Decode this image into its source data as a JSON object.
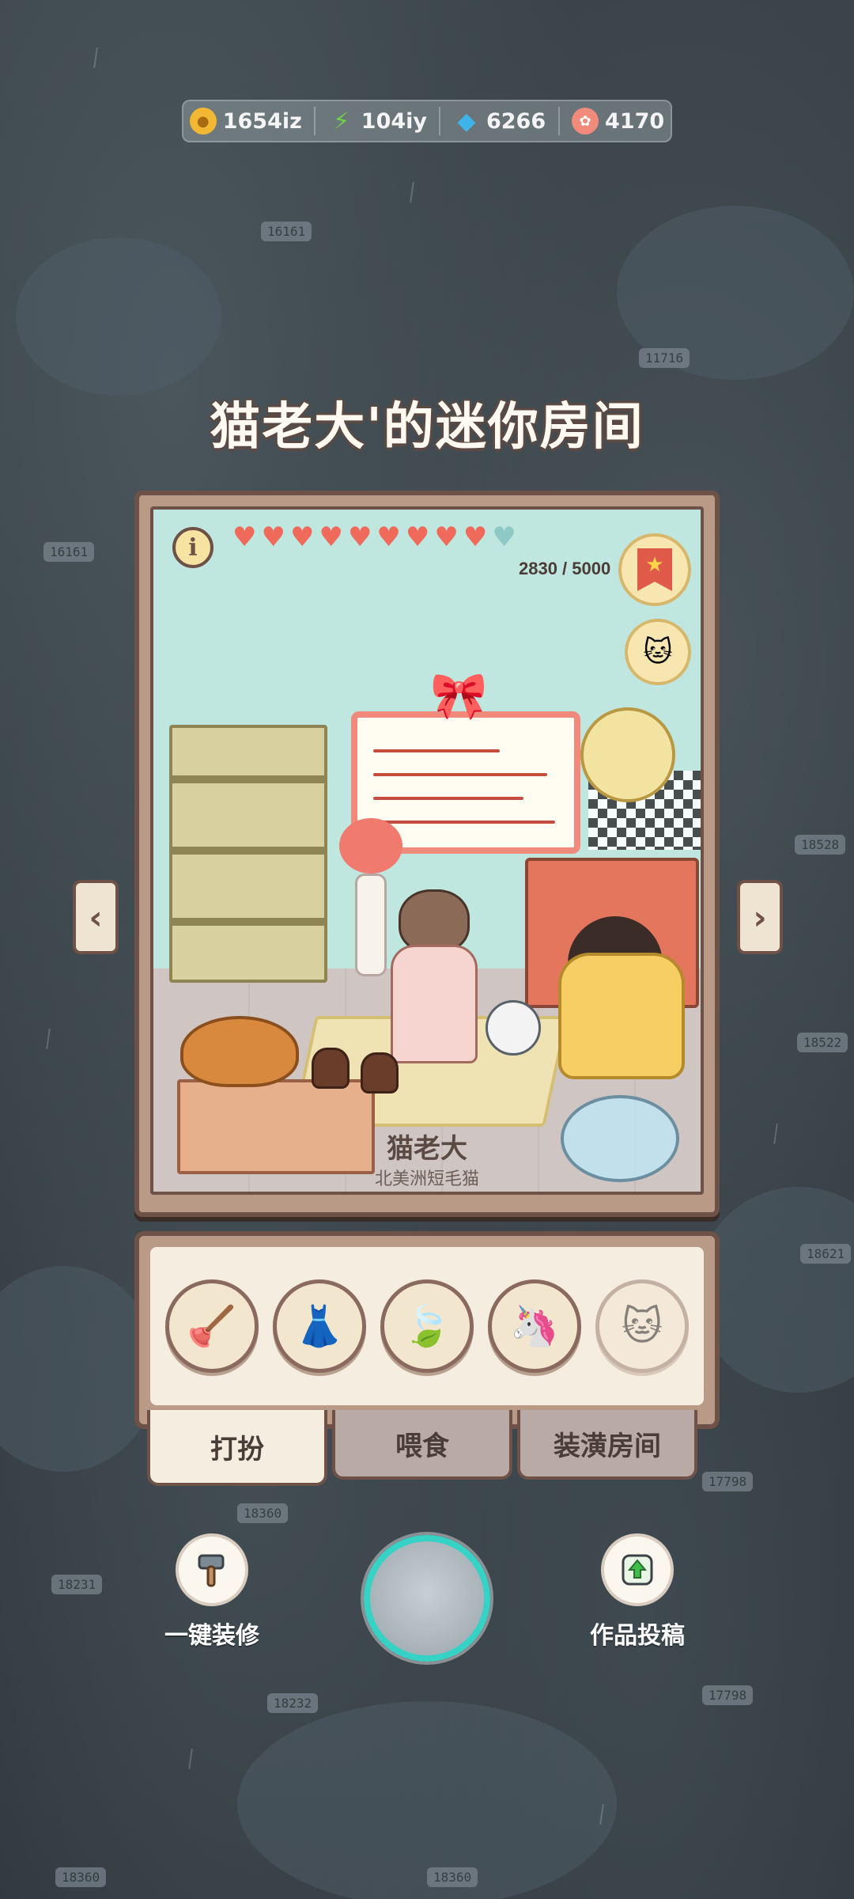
{
  "currencies": [
    {
      "name": "coin",
      "icon": "coin-icon",
      "value": "1654iz",
      "color": "#f2b733"
    },
    {
      "name": "energy",
      "icon": "lightning-icon",
      "value": "104iy",
      "color": "#6fd04a"
    },
    {
      "name": "gem",
      "icon": "gem-icon",
      "value": "6266",
      "color": "#3fb4e8"
    },
    {
      "name": "shell",
      "icon": "shell-icon",
      "value": "4170",
      "color": "#f08a7a"
    }
  ],
  "room": {
    "title": "猫老大'的迷你房间",
    "hearts_filled": 9,
    "hearts_total": 10,
    "progress_text": "2830 / 5000",
    "progress_fraction": 0.566,
    "cat_name": "猫老大",
    "cat_breed": "北美洲短毛猫"
  },
  "items": [
    {
      "icon": "plunger-icon",
      "glyph": "🪠"
    },
    {
      "icon": "dress-icon",
      "glyph": "👗"
    },
    {
      "icon": "leaf-hat-icon",
      "glyph": "🍃"
    },
    {
      "icon": "unicorn-plush-icon",
      "glyph": "🦄"
    },
    {
      "icon": "locked-item-icon",
      "glyph": "🐱"
    }
  ],
  "tabs": [
    {
      "label": "打扮",
      "active": true
    },
    {
      "label": "喂食",
      "active": false
    },
    {
      "label": "装潢房间",
      "active": false
    }
  ],
  "actions": {
    "one_click_decorate": "一键装修",
    "submit_work": "作品投稿"
  },
  "colors": {
    "accent_teal": "#37d2c6",
    "frame_brown": "#6e5247",
    "panel_cream": "#f5ede0"
  }
}
